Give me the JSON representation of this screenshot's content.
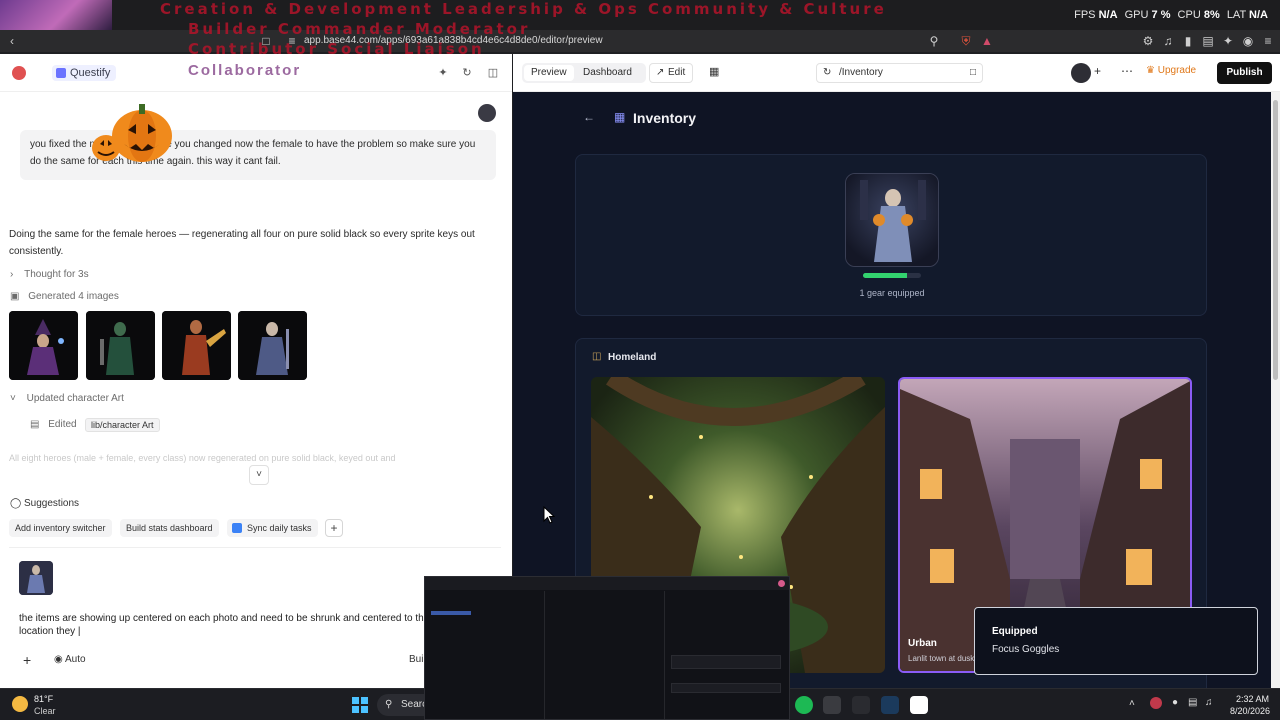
{
  "overlay": {
    "lines": [
      "Creation & Development   Leadership & Ops   Community & Culture",
      "Builder           Commander           Moderator",
      "Contributor                          Social Liaison"
    ],
    "collaborator": "Collaborator"
  },
  "perf": {
    "fps_label": "FPS",
    "fps_value": "N/A",
    "gpu_label": "GPU",
    "gpu_value": "7 %",
    "cpu_label": "CPU",
    "cpu_value": "8%",
    "lat_label": "LAT",
    "lat_value": "N/A"
  },
  "browser": {
    "url": "app.base44.com/apps/693a61a838b4cd4e6c4d8de0/editor/preview"
  },
  "editor": {
    "app_name": "Questify",
    "user_message": "you fixed the male but someone you changed now the female to have the problem so make sure you do the same for each this time again. this way it cant fail.",
    "bot_message": "Doing the same for the female heroes — regenerating all four on pure solid black so every sprite keys out consistently.",
    "thought": "Thought for 3s",
    "generated": "Generated 4 images",
    "updated": "Updated character Art",
    "edited_label": "Edited",
    "edited_file": "lib/character Art",
    "faded_text": "All eight heroes (male + female, every class) now regenerated on pure solid black, keyed out and",
    "suggestions_label": "Suggestions",
    "suggestions": [
      "Add inventory switcher",
      "Build stats dashboard",
      "Sync daily tasks"
    ],
    "composer_text": "the items are showing up centered on each photo and need to be shrunk and centered to the location they |",
    "composer_mode": "Auto",
    "composer_build": "Build"
  },
  "toolbar": {
    "preview": "Preview",
    "dashboard": "Dashboard",
    "edit": "Edit",
    "route": "/Inventory",
    "upgrade": "Upgrade",
    "publish": "Publish"
  },
  "inventory": {
    "title": "Inventory",
    "gear_equipped": "1 gear equipped",
    "gear_progress": 0.75,
    "homeland_title": "Homeland",
    "lands": [
      {
        "name": "",
        "desc": ""
      },
      {
        "name": "Urban",
        "desc": "Lanlit town at dusk"
      }
    ]
  },
  "toast": {
    "title": "Equipped",
    "desc": "Focus Goggles"
  },
  "taskbar": {
    "temp": "81°F",
    "condition": "Clear",
    "search": "Search",
    "time": "2:32 AM",
    "date": "8/20/2026"
  },
  "colors": {
    "accent": "#8b5cf6",
    "publish_bg": "#111111",
    "upgrade": "#e0781a",
    "progress": "#33d36f",
    "overlay_red": "#b3142a"
  }
}
